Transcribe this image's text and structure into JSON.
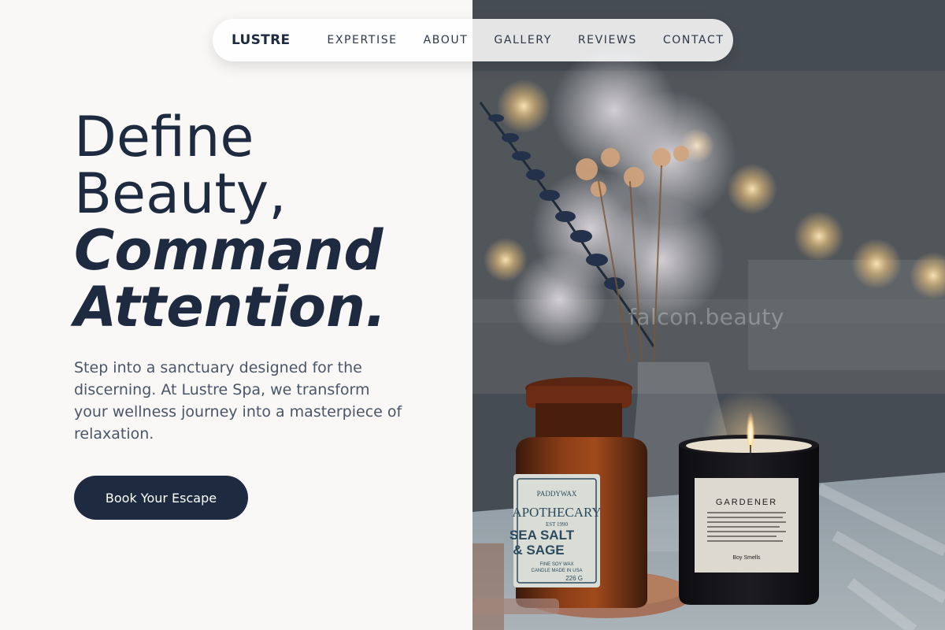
{
  "brand": {
    "name": "LUSTRE"
  },
  "nav": {
    "links": [
      {
        "label": "EXPERTISE"
      },
      {
        "label": "ABOUT"
      },
      {
        "label": "GALLERY"
      },
      {
        "label": "REVIEWS"
      },
      {
        "label": "CONTACT"
      }
    ]
  },
  "hero": {
    "heading_line1": "Define",
    "heading_line2": "Beauty,",
    "heading_line3": "Command",
    "heading_line4": "Attention.",
    "description": "Step into a sanctuary designed for the discerning. At Lustre Spa, we transform your wellness journey into a masterpiece of relaxation.",
    "cta_label": "Book Your Escape"
  },
  "photo": {
    "watermark": "falcon.beauty",
    "jar_label": {
      "brand": "PADDYWAX",
      "name": "APOTHECARY",
      "est": "EST 1990",
      "scent_line1": "SEA SALT",
      "scent_line2": "& SAGE",
      "fine_print_1": "FINE SOY WAX",
      "fine_print_2": "CANDLE MADE IN USA",
      "weight": "226 G"
    },
    "candle_label": {
      "name": "GARDENER",
      "maker": "Boy  Smells"
    }
  },
  "colors": {
    "ink": "#1e2a3f",
    "body_text": "#4a5568",
    "page_bg": "#f9f8f6",
    "nav_bg": "#ffffff"
  }
}
